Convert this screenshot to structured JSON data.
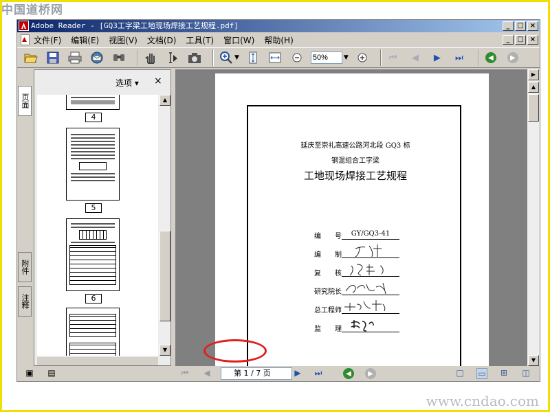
{
  "watermarks": {
    "top": "中国道桥网",
    "bottom": "www.cndao.com"
  },
  "window": {
    "title": "Adobe Reader - [GQ3工字梁工地现场焊接工艺规程.pdf]",
    "controls": {
      "minimize": "_",
      "restore": "□",
      "close": "×"
    }
  },
  "menu": {
    "items": [
      "文件(F)",
      "编辑(E)",
      "视图(V)",
      "文档(D)",
      "工具(T)",
      "窗口(W)",
      "帮助(H)"
    ]
  },
  "toolbar": {
    "zoom_value": "50%",
    "icons": [
      "open-icon",
      "save-icon",
      "print-icon",
      "email-icon",
      "search-icon",
      "hand-icon",
      "select-text-icon",
      "snapshot-icon",
      "zoom-in-tool-icon",
      "fit-page-icon",
      "fit-width-icon",
      "zoom-out-icon",
      "zoom-in-icon",
      "first-page-icon",
      "prev-page-icon",
      "next-page-icon",
      "last-page-icon",
      "back-icon",
      "forward-icon"
    ]
  },
  "side_tabs": {
    "pages": "页面",
    "attachments": "附件",
    "comments": "注释"
  },
  "pages_panel": {
    "options_label": "选项 ▾",
    "close_label": "×",
    "thumbnails": [
      {
        "label": "4"
      },
      {
        "label": "5"
      },
      {
        "label": "6"
      },
      {
        "label": ""
      }
    ]
  },
  "document": {
    "line1": "延庆至崇礼高速公路河北段 GQ3 标",
    "line2": "钢混组合工字梁",
    "title": "工地现场焊接工艺规程",
    "fields": [
      {
        "label": "编　　号",
        "value": "GY/GQ3-41"
      },
      {
        "label": "编　　制",
        "value": ""
      },
      {
        "label": "复　　核",
        "value": ""
      },
      {
        "label": "研究院长",
        "value": ""
      },
      {
        "label": "总工程师",
        "value": ""
      },
      {
        "label": "监　　理",
        "value": ""
      }
    ]
  },
  "status": {
    "page_indicator": "第 1 / 7 页",
    "highlight_color": "#e02020"
  },
  "colors": {
    "title_start": "#0a246a",
    "title_end": "#a6caf0",
    "accent_green": "#2e8b2e"
  }
}
